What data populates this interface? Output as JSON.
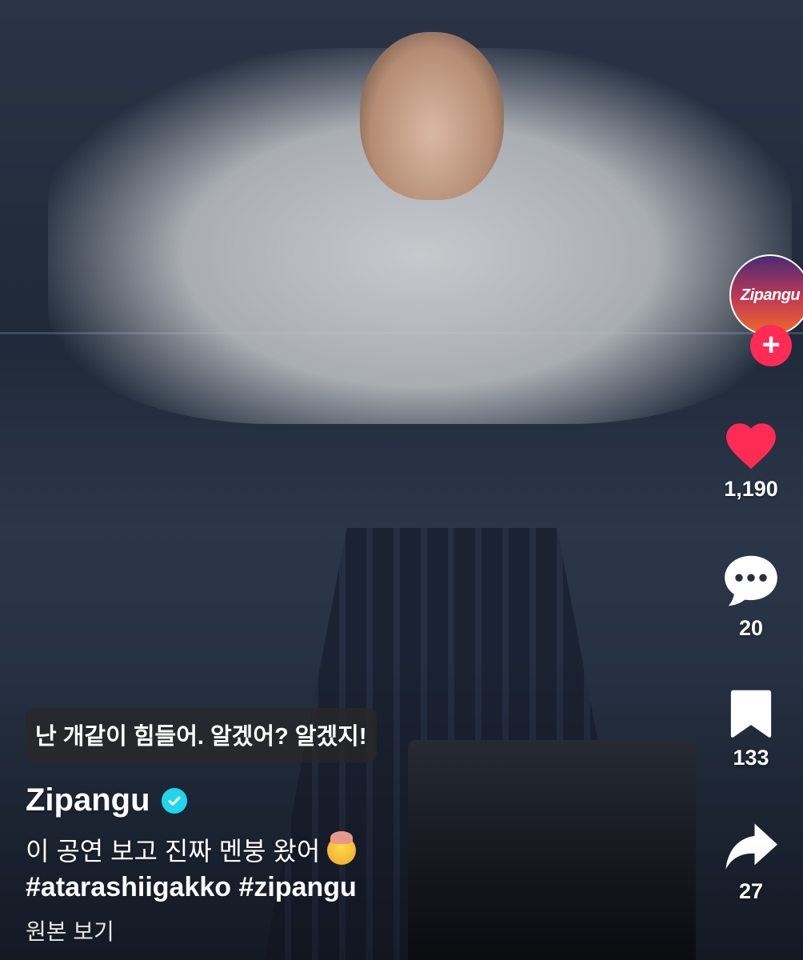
{
  "subtitle": "난 개같이 힘들어. 알겠어? 알겠지!",
  "creator": {
    "username": "Zipangu",
    "avatar_text": "Zipangu",
    "follow_label": "+"
  },
  "description": {
    "text": "이 공연 보고 진짜 멘붕 왔어",
    "emoji": "exploding-head-emoji",
    "hashtags": "#atarashiigakko #zipangu"
  },
  "see_original_label": "원본 보기",
  "actions": {
    "likes": "1,190",
    "comments": "20",
    "saves": "133",
    "shares": "27"
  },
  "colors": {
    "like": "#fe2c55",
    "follow": "#fe2c55",
    "verified": "#20d5ec"
  }
}
